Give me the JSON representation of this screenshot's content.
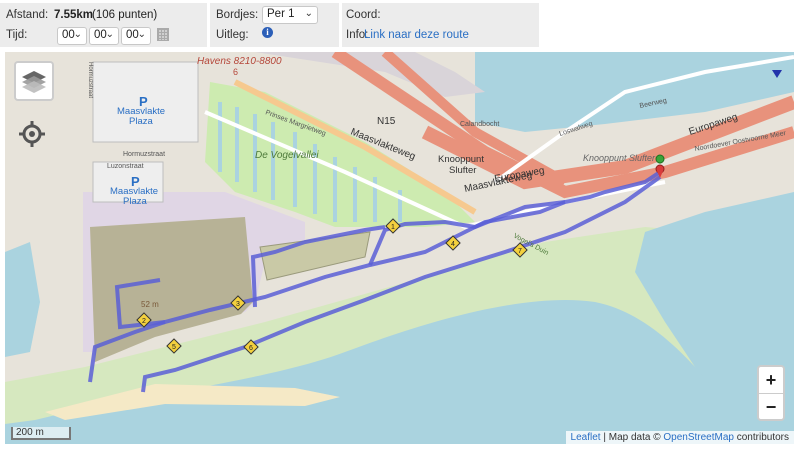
{
  "header": {
    "afstand_label": "Afstand:",
    "afstand_value": "7.55km",
    "afstand_points": "(106 punten)",
    "tijd_label": "Tijd:",
    "tijd_hh": "00",
    "tijd_mm": "00",
    "tijd_ss": "00",
    "bordjes_label": "Bordjes:",
    "bordjes_value": "Per 1",
    "uitleg_label": "Uitleg:",
    "coord_label": "Coord:",
    "info_label": "Info:",
    "info_link": "Link naar deze route"
  },
  "map": {
    "labels": {
      "havens": "Havens 8210-8800",
      "havens_num": "6",
      "n15": "N15",
      "maasvlakteweg_1": "Maasvlakteweg",
      "maasvlakteweg_2": "Maasvlakteweg",
      "europaweg_1": "Europaweg",
      "europaweg_2": "Europaweg",
      "knooppunt_1": "Knooppunt",
      "knooppunt_2": "Slufter",
      "knooppunt_slufter": "Knooppunt Slufter",
      "prinses": "Prinses Margrietweg",
      "vogelvallei": "De Vogelvallei",
      "plaza_1a": "Maasvlakte",
      "plaza_1b": "Plaza",
      "plaza_2a": "Maasvlakte",
      "plaza_2b": "Plaza",
      "hormuzstraat": "Hormuzstraat",
      "luzonstraat": "Luzonstraat",
      "hormuz_v": "Hormuzstraat",
      "beerweg": "Beerweg",
      "loswalweg": "Loswalweg",
      "noordoever": "Noordoever Oostvoorne Meer",
      "calandbocht": "Calandbocht",
      "height": "52 m",
      "duin": "Vogel's Duin",
      "parking_1": "P",
      "parking_2": "P"
    },
    "markers": [
      "1",
      "2",
      "3",
      "4",
      "5",
      "6",
      "7"
    ],
    "zoom_in": "+",
    "zoom_out": "−",
    "scale": "200 m",
    "attribution_leaflet": "Leaflet",
    "attribution_sep": " | Map data © ",
    "attribution_osm": "OpenStreetMap",
    "attribution_tail": " contributors",
    "colors": {
      "route": "#5b5fd6",
      "motorway": "#e8927c",
      "water": "#aad3df",
      "grass": "#cdebb0",
      "sand": "#f5e9c6",
      "industrial": "#e0d6e5"
    }
  }
}
